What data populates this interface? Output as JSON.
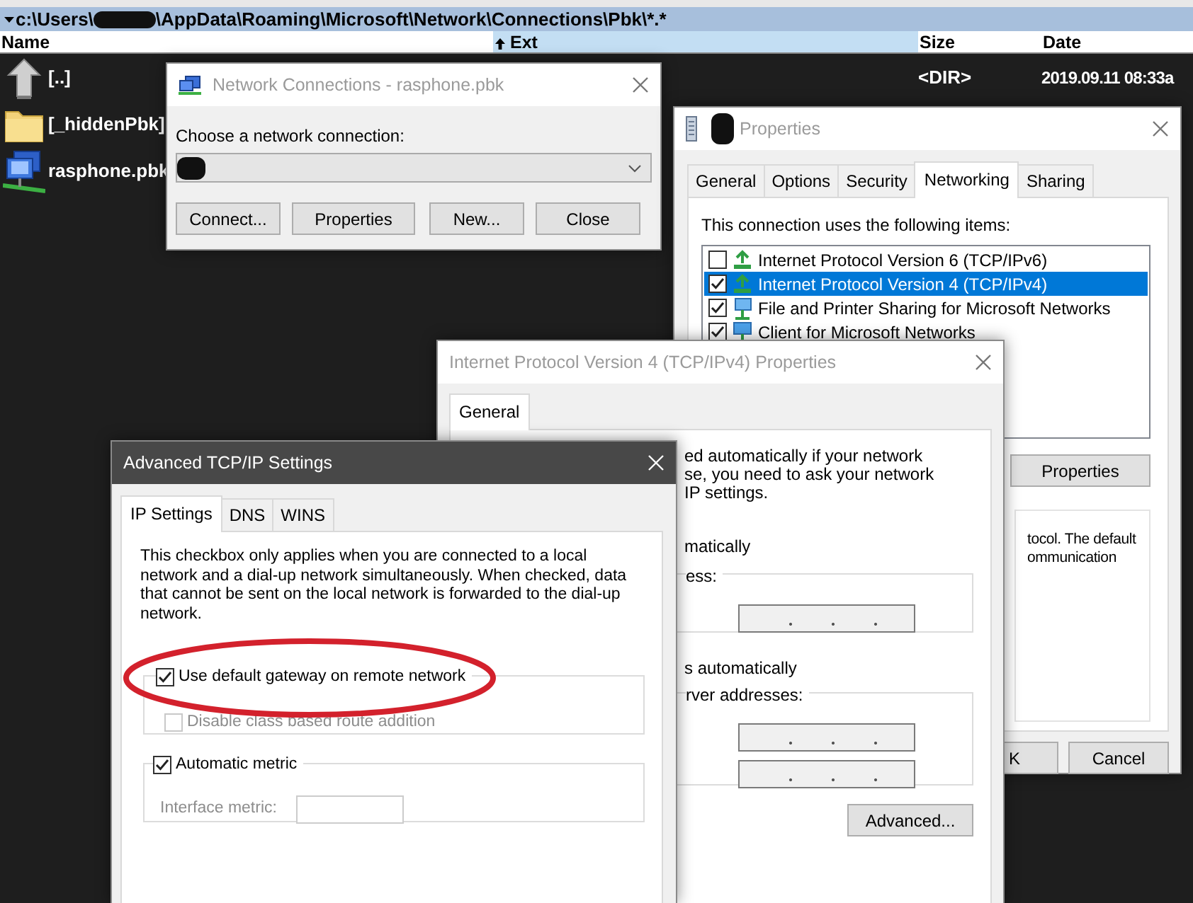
{
  "file_manager": {
    "path_prefix": "c:\\Users\\",
    "path_suffix": "\\AppData\\Roaming\\Microsoft\\Network\\Connections\\Pbk\\*.*",
    "columns": [
      {
        "label": "Name",
        "sorted": false
      },
      {
        "label": "Ext",
        "sorted": true
      },
      {
        "label": "Size",
        "sorted": false
      },
      {
        "label": "Date",
        "sorted": false
      }
    ],
    "rows": [
      {
        "kind": "up",
        "name": "[..]",
        "size": "<DIR>",
        "date": "2019.09.11 08:33a"
      },
      {
        "kind": "folder",
        "name": "[_hiddenPbk]"
      },
      {
        "kind": "phonebook",
        "name": "rasphone.pbk"
      }
    ]
  },
  "network_connections": {
    "title": "Network Connections - rasphone.pbk",
    "label": "Choose a network connection:",
    "buttons": [
      "Connect...",
      "Properties",
      "New...",
      "Close"
    ]
  },
  "properties": {
    "title": "Properties",
    "tabs": [
      {
        "label": "General",
        "selected": false
      },
      {
        "label": "Options",
        "selected": false
      },
      {
        "label": "Security",
        "selected": false
      },
      {
        "label": "Networking",
        "selected": true
      },
      {
        "label": "Sharing",
        "selected": false
      }
    ],
    "label": "This connection uses the following items:",
    "items": [
      {
        "kind": "protocol",
        "name": "Internet Protocol Version 6 (TCP/IPv6)",
        "checked": false,
        "selected": false
      },
      {
        "kind": "protocol",
        "name": "Internet Protocol Version 4 (TCP/IPv4)",
        "checked": true,
        "selected": true
      },
      {
        "kind": "sharing",
        "name": "File and Printer Sharing for Microsoft Networks",
        "checked": true,
        "selected": false
      },
      {
        "kind": "client",
        "name": "Client for Microsoft Networks",
        "checked": true,
        "selected": false
      }
    ],
    "properties_button": "Properties",
    "description": [
      "tocol. The default",
      "ommunication"
    ],
    "buttons": [
      "K",
      "Cancel"
    ]
  },
  "ipv4": {
    "title": "Internet Protocol Version 4 (TCP/IPv4) Properties",
    "tabs": [
      {
        "label": "General",
        "selected": true
      }
    ],
    "intro": [
      "ed automatically if your network",
      "se, you need to ask your network",
      "IP settings."
    ],
    "ip_option": "matically",
    "ip_group": "ess:",
    "dns_option": "s automatically",
    "dns_group": "rver addresses:",
    "advanced_button": "Advanced..."
  },
  "advanced": {
    "title": "Advanced TCP/IP Settings",
    "tabs": [
      {
        "label": "IP Settings",
        "selected": true
      },
      {
        "label": "DNS",
        "selected": false
      },
      {
        "label": "WINS",
        "selected": false
      }
    ],
    "note": "This checkbox only applies when you are connected to a local network and a dial-up network simultaneously.  When checked, data that cannot be sent on the local network is forwarded to the dial-up network.",
    "gateway": {
      "label": "Use default gateway on remote network",
      "checked": true,
      "disabled": false
    },
    "class_route": {
      "label": "Disable class based route addition",
      "checked": false,
      "disabled": true
    },
    "auto_metric": {
      "label": "Automatic metric",
      "checked": true,
      "disabled": false
    },
    "interface_metric": {
      "label": "Interface metric:",
      "disabled": true
    }
  }
}
